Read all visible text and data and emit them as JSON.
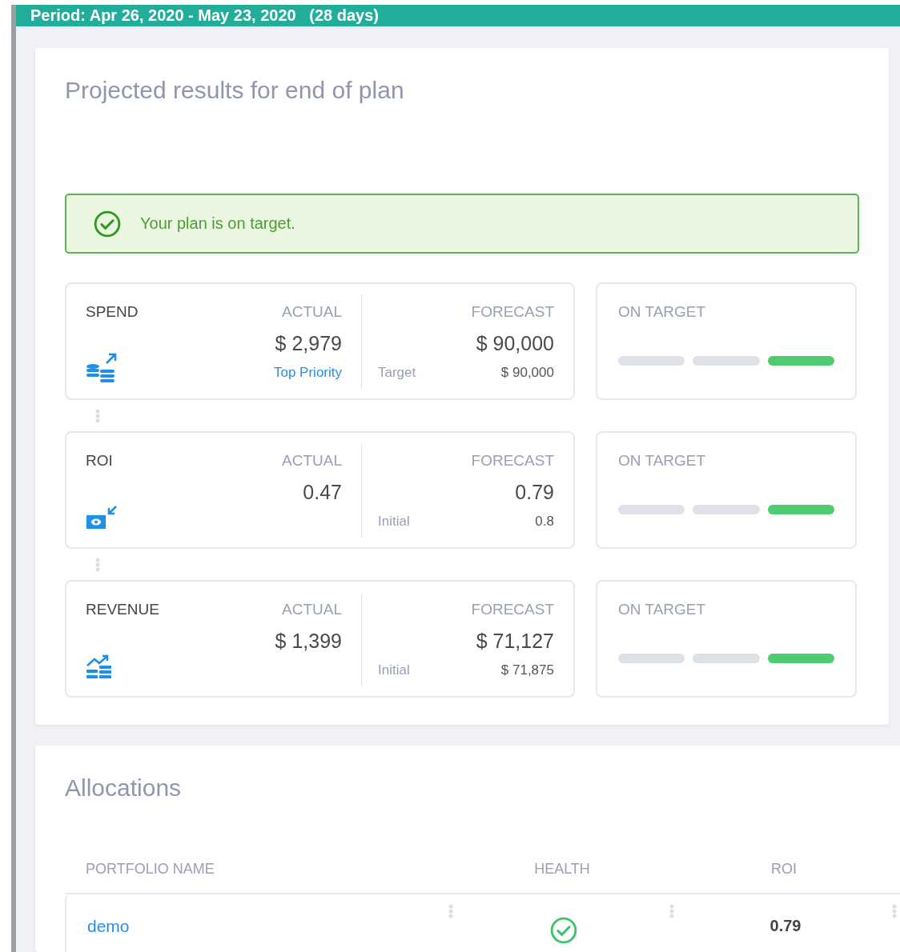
{
  "period": "Period: Apr 26, 2020 - May 23, 2020   (28 days)",
  "projection": {
    "title": "Projected results for end of plan",
    "banner": {
      "kind": "success",
      "text": "Your plan is on target."
    },
    "metrics": [
      {
        "name": "SPEND",
        "kind": "coins",
        "actual_label": "ACTUAL",
        "actual": "$ 2,979",
        "actual_link": "Top Priority",
        "forecast_label": "FORECAST",
        "forecast": "$ 90,000",
        "sub_label": "Target",
        "sub_value": "$ 90,000",
        "status": "ON TARGET",
        "segments": [
          {
            "active": false
          },
          {
            "active": false
          },
          {
            "active": true
          }
        ]
      },
      {
        "name": "ROI",
        "kind": "money",
        "actual_label": "ACTUAL",
        "actual": "0.47",
        "forecast_label": "FORECAST",
        "forecast": "0.79",
        "sub_label": "Initial",
        "sub_value": "0.8",
        "status": "ON TARGET",
        "segments": [
          {
            "active": false
          },
          {
            "active": false
          },
          {
            "active": true
          }
        ]
      },
      {
        "name": "REVENUE",
        "kind": "chart",
        "actual_label": "ACTUAL",
        "actual": "$ 1,399",
        "forecast_label": "FORECAST",
        "forecast": "$ 71,127",
        "sub_label": "Initial",
        "sub_value": "$ 71,875",
        "status": "ON TARGET",
        "segments": [
          {
            "active": false
          },
          {
            "active": false
          },
          {
            "active": true
          }
        ]
      }
    ]
  },
  "allocations": {
    "title": "Allocations",
    "columns": [
      "PORTFOLIO NAME",
      "HEALTH",
      "ROI"
    ],
    "rows": [
      {
        "name": "demo",
        "healthy": true,
        "roi": "0.79"
      }
    ]
  }
}
